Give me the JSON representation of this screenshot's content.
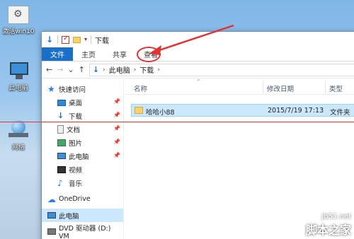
{
  "desktop": {
    "icons": [
      {
        "label": "激活win10"
      },
      {
        "label": "此电脑"
      },
      {
        "label": "网络"
      }
    ]
  },
  "window": {
    "title": "下载",
    "quickaccess": {
      "dropdown": "▾"
    },
    "ribbon": {
      "tabs": [
        "文件",
        "主页",
        "共享",
        "查看"
      ]
    },
    "nav": {
      "back": "←",
      "forward": "→",
      "recent": "⌄",
      "up": "↑"
    },
    "address": {
      "crumbs": [
        "此电脑",
        "下载"
      ],
      "separator": "›"
    },
    "navpane": {
      "items": [
        {
          "label": "快速访问",
          "icon": "star-icon"
        },
        {
          "label": "桌面",
          "icon": "desktop-icon",
          "pinned": true
        },
        {
          "label": "下载",
          "icon": "download-icon",
          "pinned": true
        },
        {
          "label": "文档",
          "icon": "document-icon",
          "pinned": true
        },
        {
          "label": "图片",
          "icon": "picture-icon",
          "pinned": true
        },
        {
          "label": "此电脑",
          "icon": "computer-icon",
          "pinned": true
        },
        {
          "label": "视频",
          "icon": "video-icon"
        },
        {
          "label": "音乐",
          "icon": "music-icon"
        },
        {
          "label": "OneDrive",
          "icon": "cloud-icon"
        },
        {
          "label": "此电脑",
          "icon": "computer-icon",
          "selected": true
        },
        {
          "label": "DVD 驱动器 (D:) VM",
          "icon": "dvd-icon"
        }
      ],
      "pin_glyph": "📌"
    },
    "columns": {
      "name": "名称",
      "date": "修改日期",
      "type": "类型",
      "sort": "⌃"
    },
    "files": [
      {
        "name": "哈哈小88",
        "date": "2015/7/19 17:13",
        "type": "文件夹"
      }
    ]
  },
  "watermark": {
    "url": "jb51.net",
    "brand": "脚本之家"
  },
  "colors": {
    "accent": "#1a6fc9",
    "selection": "#cce8ff",
    "annotation": "#e03333"
  }
}
